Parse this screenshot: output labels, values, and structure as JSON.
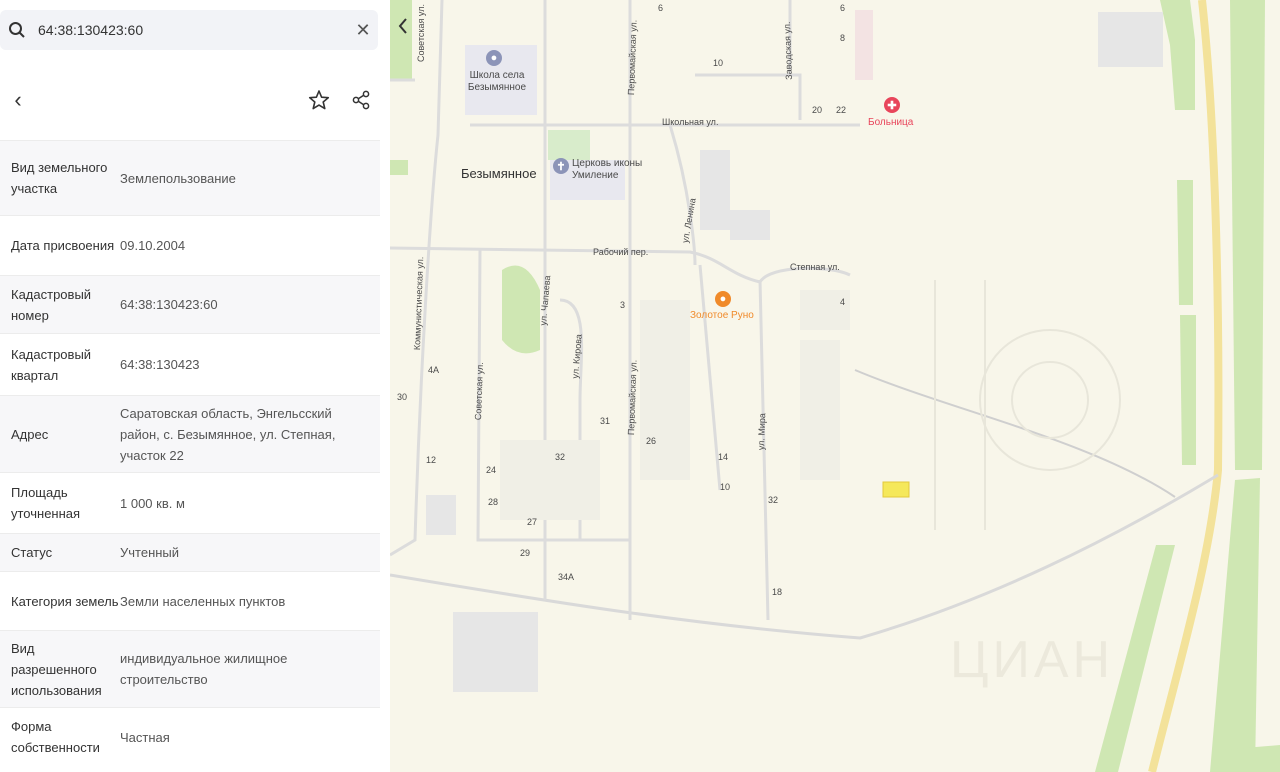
{
  "search": {
    "value": "64:38:130423:60"
  },
  "card": {
    "rows": [
      {
        "label": "Вид земельного участка",
        "value": "Землепользование"
      },
      {
        "label": "Дата присвоения",
        "value": "09.10.2004"
      },
      {
        "label": "Кадастровый номер",
        "value": "64:38:130423:60"
      },
      {
        "label": "Кадастровый квартал",
        "value": "64:38:130423"
      },
      {
        "label": "Адрес",
        "value": "Саратовская область, Энгельсский район, с. Безымянное, ул. Степная, участок 22"
      },
      {
        "label": "Площадь уточненная",
        "value": "1 000 кв. м"
      },
      {
        "label": "Статус",
        "value": "Учтенный"
      },
      {
        "label": "Категория земель",
        "value": "Земли населенных пунктов"
      },
      {
        "label": "Вид разрешенного использования",
        "value": "индивидуальное жилищное строительство"
      },
      {
        "label": "Форма собственности",
        "value": "Частная"
      }
    ]
  },
  "map": {
    "pois": {
      "school": "Школа села Безымянное",
      "village": "Безымянное",
      "church": "Церковь иконы Умиление",
      "hospital": "Больница",
      "shop": "Золотое Руно"
    },
    "streets": {
      "sovetskaya_top": "Советская ул.",
      "pervomayskaya_top": "Первомайская ул.",
      "zavodskaya": "Заводская ул.",
      "shkolnaya": "Школьная ул.",
      "rabochiy": "Рабочий пер.",
      "stepnaya": "Степная ул.",
      "kommunisticheskaya": "Коммунистическая ул.",
      "chapaeva": "ул. Чапаева",
      "kirova": "ул. Кирова",
      "sovetskaya": "Советская ул.",
      "pervomayskaya": "Первомайская ул.",
      "lenina": "ул. Ленина",
      "ulitsa_right": "ул. Мира"
    },
    "house_numbers": {
      "h6": "6",
      "h8": "8",
      "h10": "10",
      "h20": "20",
      "h22": "22",
      "h4": "4",
      "h3": "3",
      "h4a": "4А",
      "h30": "30",
      "h12": "12",
      "h24": "24",
      "h28": "28",
      "h27": "27",
      "h29": "29",
      "h34a": "34А",
      "h32": "32",
      "h31": "31",
      "h26": "26",
      "h14": "14",
      "h18": "18"
    },
    "watermark": "ЦИАН"
  },
  "colors": {
    "hospital": "#e8455b",
    "shop": "#f08a2a",
    "parcel": "#f5e85a",
    "green": "#cfe7b3",
    "road_yellow": "#f3e29a"
  }
}
